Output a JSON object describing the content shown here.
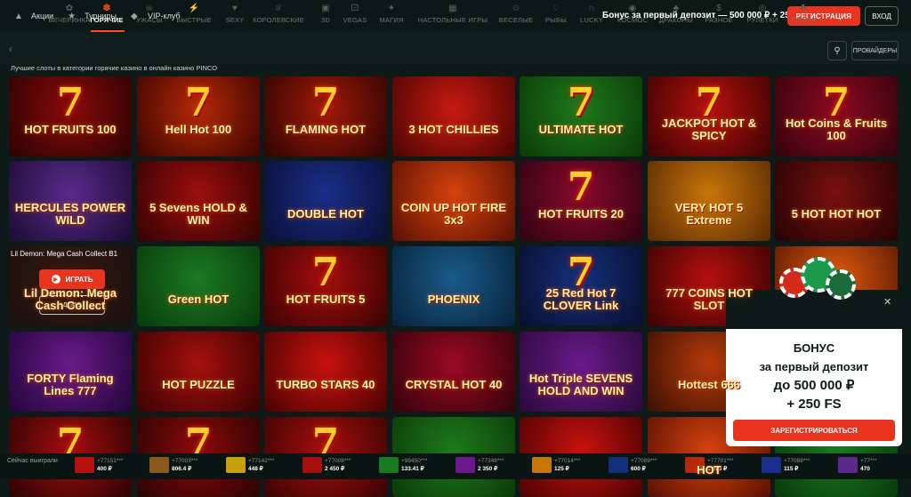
{
  "topbar": {
    "links": [
      {
        "label": "Акции",
        "icon": "megaphone-icon"
      },
      {
        "label": "Турниры",
        "icon": "trophy-icon"
      },
      {
        "label": "VIP-клуб",
        "icon": "diamond-icon"
      }
    ],
    "bonus": "Бонус за первый депозит — 500 000 ₽ + 250 FS",
    "register": "РЕГИСТРАЦИЯ",
    "login": "ВХОД"
  },
  "categories": [
    {
      "label": "ВЕЧЕРИНКА",
      "icon": "party-icon"
    },
    {
      "label": "ГОРЯЧИЕ",
      "icon": "fire-icon",
      "active": true
    },
    {
      "label": "УЖАСЫ",
      "icon": "skull-icon"
    },
    {
      "label": "БЫСТРЫЕ",
      "icon": "lightning-icon"
    },
    {
      "label": "SEXY",
      "icon": "heart-icon"
    },
    {
      "label": "КОРОЛЕВСКИЕ",
      "icon": "crown-icon"
    },
    {
      "label": "3D",
      "icon": "cube-icon"
    },
    {
      "label": "VEGAS",
      "icon": "dice-icon"
    },
    {
      "label": "МАГИЯ",
      "icon": "wand-icon"
    },
    {
      "label": "НАСТОЛЬНЫЕ ИГРЫ",
      "icon": "table-icon"
    },
    {
      "label": "ВЕСЕЛЫЕ",
      "icon": "smile-icon"
    },
    {
      "label": "РЫБЫ",
      "icon": "fish-icon"
    },
    {
      "label": "LUCKY",
      "icon": "horseshoe-icon"
    },
    {
      "label": "КОСМОС",
      "icon": "planet-icon"
    },
    {
      "label": "ДРАКОНЫ",
      "icon": "dragon-icon"
    },
    {
      "label": "РАЗНОЕ",
      "icon": "dollar-icon"
    },
    {
      "label": "РУЛЕТКИ",
      "icon": "roulette-icon"
    },
    {
      "label": "СЛОТЫ",
      "icon": "cherry-icon"
    }
  ],
  "search_icon": "search-icon",
  "providers": "ПРОВАЙДЕРЫ",
  "subtitle": "Лучшие слоты в категории горячие казино в онлайн казино PINCO",
  "games": [
    {
      "title": "HOT FRUITS 100",
      "c1": "#8b0a0a",
      "c2": "#2a0303",
      "seven": true
    },
    {
      "title": "Hell Hot 100",
      "c1": "#b5290a",
      "c2": "#3b0500",
      "seven": true
    },
    {
      "title": "FLAMING HOT",
      "c1": "#a11a0a",
      "c2": "#2e0402",
      "seven": true
    },
    {
      "title": "3 HOT CHILLIES",
      "c1": "#c71a10",
      "c2": "#4a0503",
      "seven": false
    },
    {
      "title": "ULTIMATE HOT",
      "c1": "#1d7a1a",
      "c2": "#0b3a09",
      "seven": true
    },
    {
      "title": "JACKPOT HOT & SPICY",
      "c1": "#b5120e",
      "c2": "#3d0303",
      "seven": true
    },
    {
      "title": "Hot Coins & Fruits 100",
      "c1": "#8d0a22",
      "c2": "#33030c",
      "seven": true
    },
    {
      "title": "HERCULES POWER WILD",
      "c1": "#5a2a8a",
      "c2": "#1c0c33",
      "seven": false
    },
    {
      "title": "5 Sevens HOLD & WIN",
      "c1": "#9d0e0e",
      "c2": "#330303",
      "seven": false
    },
    {
      "title": "DOUBLE HOT",
      "c1": "#1a2f8a",
      "c2": "#0a0f33",
      "seven": false
    },
    {
      "title": "COIN UP HOT FIRE 3x3",
      "c1": "#d4420e",
      "c2": "#5a1003",
      "seven": false
    },
    {
      "title": "HOT FRUITS 20",
      "c1": "#8b0a2e",
      "c2": "#2e0310",
      "seven": true
    },
    {
      "title": "VERY HOT 5 Extreme",
      "c1": "#c7760a",
      "c2": "#5a2a03",
      "seven": false
    },
    {
      "title": "5 HOT HOT HOT",
      "c1": "#7a1010",
      "c2": "#250303",
      "seven": false
    },
    {
      "title": "Lil Demon: Mega Cash Collect",
      "c1": "#8b2a0a",
      "c2": "#2b0a02",
      "seven": false
    },
    {
      "title": "Green HOT",
      "c1": "#1a7a22",
      "c2": "#083a0c",
      "seven": false
    },
    {
      "title": "HOT FRUITS 5",
      "c1": "#a50e0e",
      "c2": "#3a0303",
      "seven": true
    },
    {
      "title": "PHOENIX",
      "c1": "#1a5a8a",
      "c2": "#08233a",
      "seven": false
    },
    {
      "title": "25 Red Hot 7 CLOVER Link",
      "c1": "#15307a",
      "c2": "#070f2e",
      "seven": true
    },
    {
      "title": "777 COINS HOT SLOT",
      "c1": "#b5100e",
      "c2": "#3a0303",
      "seven": false
    },
    {
      "title": "",
      "c1": "#e05a0e",
      "c2": "#5a1803",
      "seven": false
    },
    {
      "title": "FORTY Flaming Lines 777",
      "c1": "#6a1a8a",
      "c2": "#22063a",
      "seven": false
    },
    {
      "title": "HOT PUZZLE",
      "c1": "#a5100e",
      "c2": "#3a0303",
      "seven": false
    },
    {
      "title": "TURBO STARS 40",
      "c1": "#c7120e",
      "c2": "#4a0303",
      "seven": false
    },
    {
      "title": "CRYSTAL HOT 40",
      "c1": "#9b0a22",
      "c2": "#33030b",
      "seven": false
    },
    {
      "title": "Hot Triple SEVENS HOLD AND WIN",
      "c1": "#6a1a8a",
      "c2": "#2a0a3a",
      "seven": false
    },
    {
      "title": "Hottest 666",
      "c1": "#b53a0a",
      "c2": "#3a1003",
      "seven": false
    },
    {
      "title": "",
      "c1": "#0c1a17",
      "c2": "#0c1a17",
      "seven": false
    },
    {
      "title": "",
      "c1": "#a50e0e",
      "c2": "#2a0303",
      "seven": true
    },
    {
      "title": "",
      "c1": "#8b0a0a",
      "c2": "#2a0303",
      "seven": true
    },
    {
      "title": "",
      "c1": "#a5100e",
      "c2": "#3a0303",
      "seven": true
    },
    {
      "title": "",
      "c1": "#1d7a1a",
      "c2": "#0b3a09",
      "seven": false
    },
    {
      "title": "",
      "c1": "#c7120e",
      "c2": "#4a0303",
      "seven": false
    },
    {
      "title": "HOT",
      "c1": "#d4420e",
      "c2": "#5a1003",
      "seven": false
    },
    {
      "title": "",
      "c1": "#1a7a22",
      "c2": "#083a0c",
      "seven": false
    }
  ],
  "hover": {
    "name": "Lil Demon: Mega Cash Collect B1",
    "play": "ИГРАТЬ",
    "demo": "ДЕМО"
  },
  "popup": {
    "line1": "БОНУС",
    "line2": "за первый депозит",
    "line3": "до 500 000 ₽",
    "line4": "+ 250 FS",
    "button": "ЗАРЕГИСТРИРОВАТЬСЯ"
  },
  "winners": {
    "title": "Сейчас выиграли",
    "items": [
      {
        "user": "+77151***",
        "amount": "400 ₽",
        "color": "#b5120e"
      },
      {
        "user": "+77003***",
        "amount": "806.4 ₽",
        "color": "#8a5a1a"
      },
      {
        "user": "+77142***",
        "amount": "448 ₽",
        "color": "#c7a00e"
      },
      {
        "user": "+77008***",
        "amount": "2 450 ₽",
        "color": "#a5100e"
      },
      {
        "user": "+99450***",
        "amount": "133.41 ₽",
        "color": "#1a7a22"
      },
      {
        "user": "+77348***",
        "amount": "2 350 ₽",
        "color": "#6a1a8a"
      },
      {
        "user": "+77014***",
        "amount": "125 ₽",
        "color": "#c7760a"
      },
      {
        "user": "+77089***",
        "amount": "600 ₽",
        "color": "#15307a"
      },
      {
        "user": "+77701***",
        "amount": "2 075 ₽",
        "color": "#b5290a"
      },
      {
        "user": "+77088***",
        "amount": "115 ₽",
        "color": "#1a2f8a"
      },
      {
        "user": "+77***",
        "amount": "470",
        "color": "#5a2a8a"
      }
    ]
  },
  "colors": {
    "accent": "#e8331e",
    "bg": "#0d1a17",
    "active_cat": "#ff4a1a"
  }
}
